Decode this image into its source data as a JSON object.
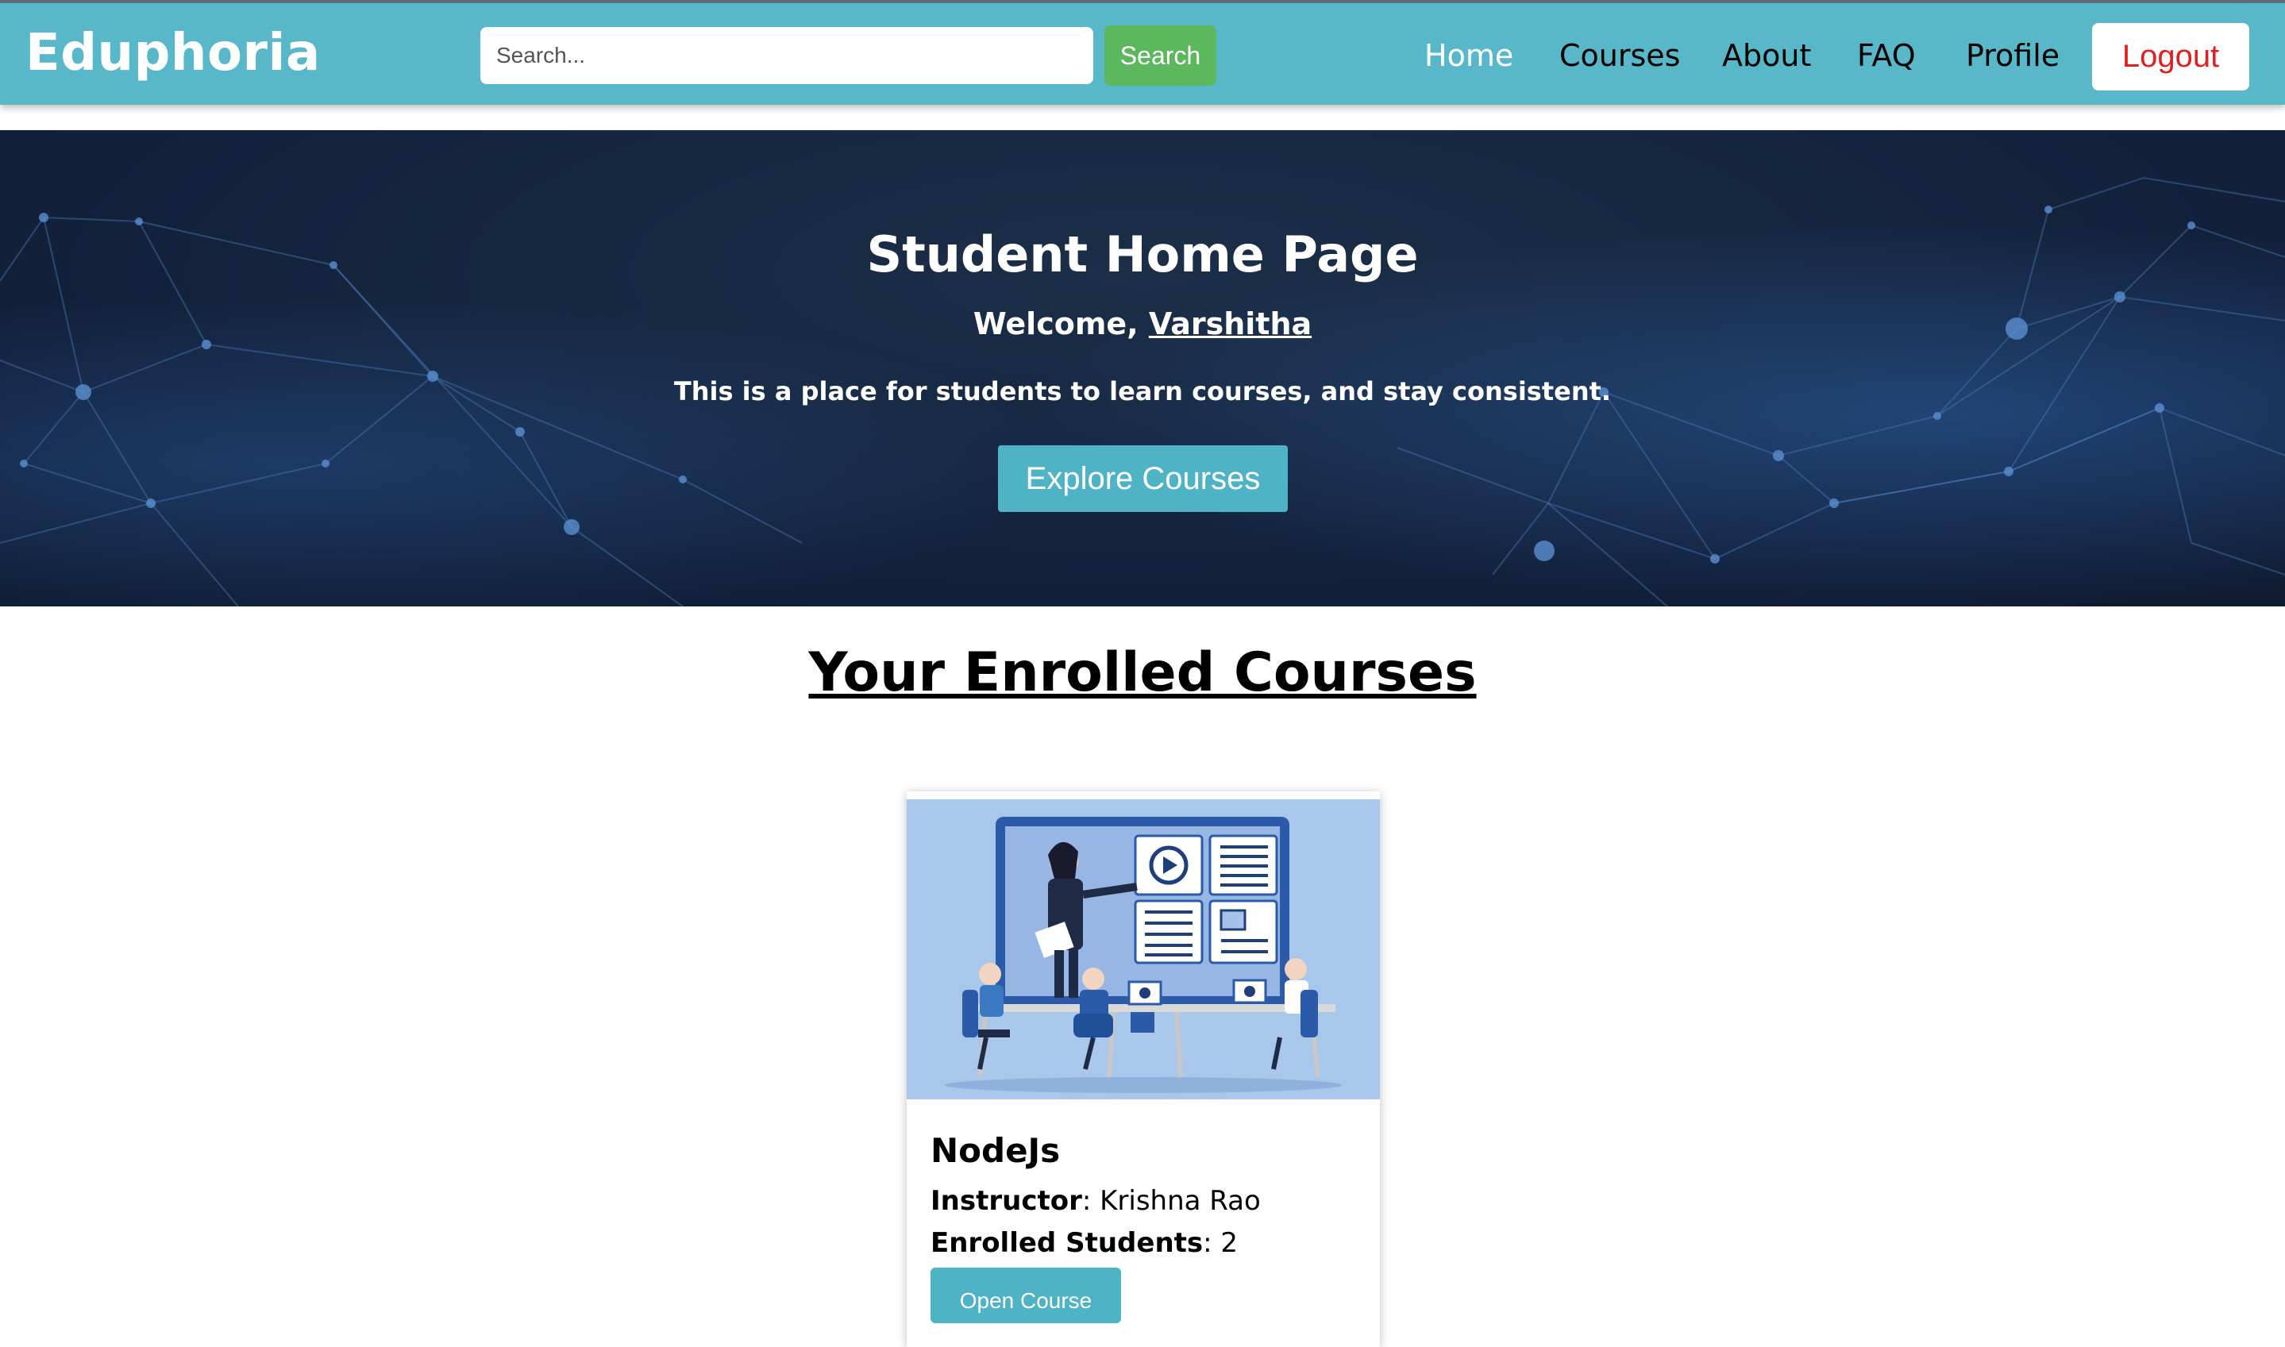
{
  "header": {
    "brand": "Eduphoria",
    "search_placeholder": "Search...",
    "search_button": "Search",
    "nav": {
      "home": "Home",
      "courses": "Courses",
      "about": "About",
      "faq": "FAQ",
      "profile": "Profile",
      "logout": "Logout"
    }
  },
  "hero": {
    "title": "Student Home Page",
    "welcome_prefix": "Welcome, ",
    "username": "Varshitha",
    "tagline": "This is a place for students to learn courses, and stay consistent.",
    "explore_button": "Explore Courses"
  },
  "enrolled": {
    "title": "Your Enrolled Courses",
    "courses": [
      {
        "name": "NodeJs",
        "instructor_label": "Instructor",
        "instructor": "Krishna Rao",
        "students_label": "Enrolled Students",
        "students": "2",
        "open_button": "Open Course"
      }
    ]
  },
  "colors": {
    "navbar": "#58b7c9",
    "search_button": "#5cb85c",
    "logout_text": "#e02020",
    "accent_button": "#4fb3c6"
  }
}
